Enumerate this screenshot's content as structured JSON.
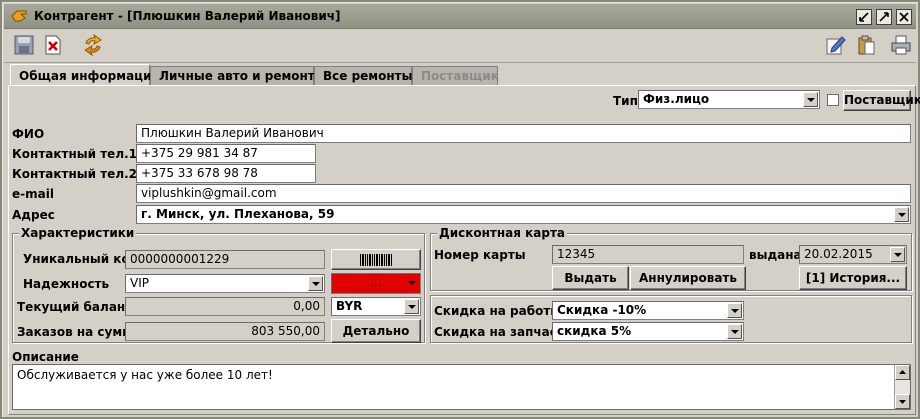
{
  "window": {
    "title": "Контрагент - [Плюшкин Валерий Иванович]"
  },
  "toolbar": {
    "save_icon": "save-icon",
    "delete_icon": "delete-icon",
    "refresh_icon": "refresh-icon",
    "edit_icon": "edit-icon",
    "clipboard_icon": "clipboard-icon",
    "print_icon": "print-icon"
  },
  "tabs": [
    {
      "label": "Общая информация",
      "active": true
    },
    {
      "label": "Личные авто и ремонты"
    },
    {
      "label": "Все ремонты"
    },
    {
      "label": "Поставщик",
      "disabled": true
    }
  ],
  "type_row": {
    "label": "Тип",
    "value": "Физ.лицо",
    "supplier_label": "Поставщик",
    "supplier_checked": false
  },
  "contact": {
    "fio_label": "ФИО",
    "fio": "Плюшкин Валерий Иванович",
    "phone1_label": "Контактный тел.1",
    "phone1": "+375 29 981 34 87",
    "phone2_label": "Контактный тел.2",
    "phone2": "+375 33 678 98 78",
    "email_label": "e-mail",
    "email": "viplushkin@gmail.com",
    "address_label": "Адрес",
    "address": "г. Минск, ул. Плеханова, 59"
  },
  "characteristics": {
    "title": "Характеристики",
    "code_label": "Уникальный код",
    "code": "0000000001229",
    "reliability_label": "Надежность",
    "reliability": "VIP",
    "color_value": "...",
    "balance_label": "Текущий баланс",
    "balance": "0,00",
    "currency": "BYR",
    "orders_label": "Заказов на сумму",
    "orders": "803 550,00",
    "details_label": "Детально"
  },
  "discount_card": {
    "title": "Дисконтная карта",
    "card_number_label": "Номер карты",
    "card_number": "12345",
    "issued_label": "выдана",
    "issued": "20.02.2015",
    "issue_button": "Выдать",
    "cancel_button": "Аннулировать",
    "history_button": "[1] История...",
    "work_discount_label": "Скидка на работы",
    "work_discount": "Скидка -10%",
    "parts_discount_label": "Скидка на запчасти",
    "parts_discount": "скидка 5%"
  },
  "description": {
    "label": "Описание",
    "text": "Обслуживается у нас уже более 10 лет!"
  },
  "colors": {
    "reliability_color": "#e00000",
    "titlebar": "#9a9d8d",
    "window_bg": "#d4d0c8"
  }
}
